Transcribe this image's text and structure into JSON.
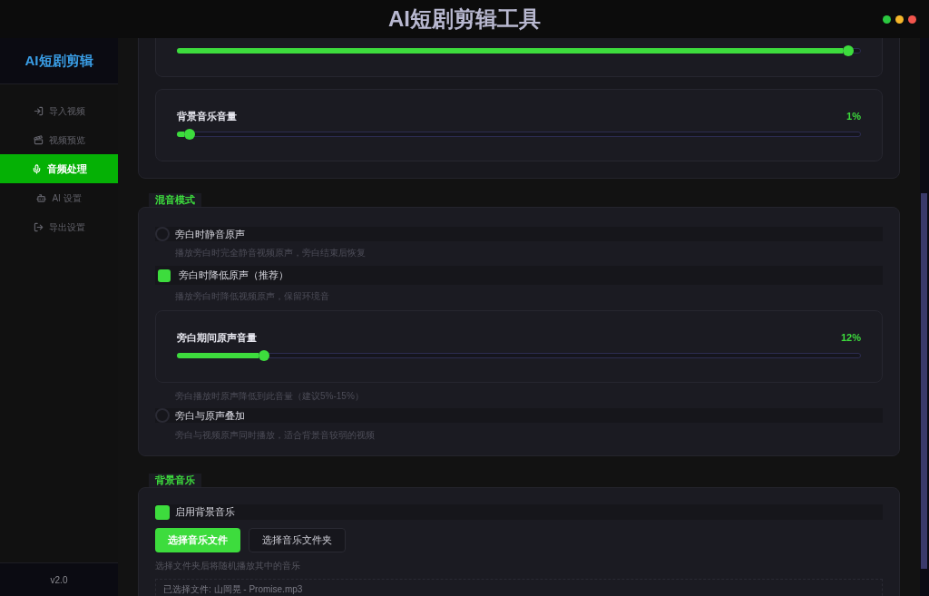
{
  "title_bar": {
    "title": "AI短剧剪辑工具"
  },
  "sidebar": {
    "logo": "AI短剧剪辑",
    "items": [
      {
        "label": "导入视频",
        "selected": false
      },
      {
        "label": "视频预览",
        "selected": false
      },
      {
        "label": "音频处理",
        "selected": true
      },
      {
        "label": "AI 设置",
        "selected": false
      },
      {
        "label": "导出设置",
        "selected": false
      }
    ],
    "version": "v2.0"
  },
  "volume_settings": {
    "sliders": [
      {
        "level": 0.99
      },
      {
        "label": "背景音乐音量",
        "reading": "1%",
        "level": 0.01
      }
    ]
  },
  "mix_mode": {
    "title": "混音模式",
    "options": [
      {
        "label": "旁白时静音原声",
        "selected": false,
        "description": "播放旁白时完全静音视频原声，旁白结束后恢复"
      },
      {
        "label": "旁白时降低原声（推荐）",
        "selected": true,
        "description": "播放旁白时降低视频原声，保留环境音",
        "slider": {
          "label": "旁白期间原声音量",
          "reading": "12%",
          "level": 0.12,
          "hint": "旁白播放时原声降低到此音量（建议5%-15%）"
        }
      },
      {
        "label": "旁白与原声叠加",
        "selected": false,
        "description": "旁白与视频原声同时播放，适合背景音较弱的视频"
      }
    ]
  },
  "background_music": {
    "title": "背景音乐",
    "enable": {
      "label": "启用背景音乐",
      "checked": true
    },
    "buttons": [
      {
        "label": "选择音乐文件",
        "kind": "primary"
      },
      {
        "label": "选择音乐文件夹",
        "kind": "secondary"
      }
    ],
    "hint": "选择文件夹后将随机播放其中的音乐",
    "selected_file": "已选择文件: 山岡晃 - Promise.mp3"
  }
}
